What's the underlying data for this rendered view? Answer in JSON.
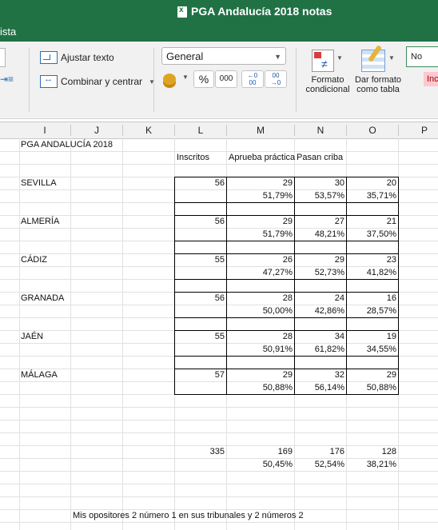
{
  "window": {
    "title": "PGA Andalucía 2018 notas",
    "tab_fragment": "ista"
  },
  "ribbon": {
    "wrap_text": "Ajustar texto",
    "merge_center": "Combinar y centrar",
    "number_format": "General",
    "percent": "%",
    "thousands": "000",
    "dec_increase": "←0\n00",
    "dec_decrease": "00\n→0",
    "cond_format_line1": "Formato",
    "cond_format_line2": "condicional",
    "table_format_line1": "Dar formato",
    "table_format_line2": "como tabla",
    "style_normal": "No",
    "style_bad": "Inc"
  },
  "columns": [
    "I",
    "J",
    "K",
    "L",
    "M",
    "N",
    "O",
    "P"
  ],
  "sheet": {
    "title_cell": "PGA ANDALUCÍA 2018",
    "headers": {
      "inscritos": "Inscritos",
      "aprueba": "Aprueba práctica",
      "pasan": "Pasan criba"
    },
    "provinces": [
      {
        "name": "SEVILLA",
        "inscritos": "56",
        "aprueba": "29",
        "pasan": "30",
        "o": "20",
        "pct_m": "51,79%",
        "pct_n": "53,57%",
        "pct_o": "35,71%"
      },
      {
        "name": "ALMERÍA",
        "inscritos": "56",
        "aprueba": "29",
        "pasan": "27",
        "o": "21",
        "pct_m": "51,79%",
        "pct_n": "48,21%",
        "pct_o": "37,50%"
      },
      {
        "name": "CÁDIZ",
        "inscritos": "55",
        "aprueba": "26",
        "pasan": "29",
        "o": "23",
        "pct_m": "47,27%",
        "pct_n": "52,73%",
        "pct_o": "41,82%"
      },
      {
        "name": "GRANADA",
        "inscritos": "56",
        "aprueba": "28",
        "pasan": "24",
        "o": "16",
        "pct_m": "50,00%",
        "pct_n": "42,86%",
        "pct_o": "28,57%"
      },
      {
        "name": "JAÉN",
        "inscritos": "55",
        "aprueba": "28",
        "pasan": "34",
        "o": "19",
        "pct_m": "50,91%",
        "pct_n": "61,82%",
        "pct_o": "34,55%"
      },
      {
        "name": "MÁLAGA",
        "inscritos": "57",
        "aprueba": "29",
        "pasan": "32",
        "o": "29",
        "pct_m": "50,88%",
        "pct_n": "56,14%",
        "pct_o": "50,88%"
      }
    ],
    "totals": {
      "inscritos": "335",
      "aprueba": "169",
      "pasan": "176",
      "o": "128",
      "pct_m": "50,45%",
      "pct_n": "52,54%",
      "pct_o": "38,21%"
    },
    "note": "Mis opositores 2 número 1 en sus tribunales y 2 números 2"
  }
}
